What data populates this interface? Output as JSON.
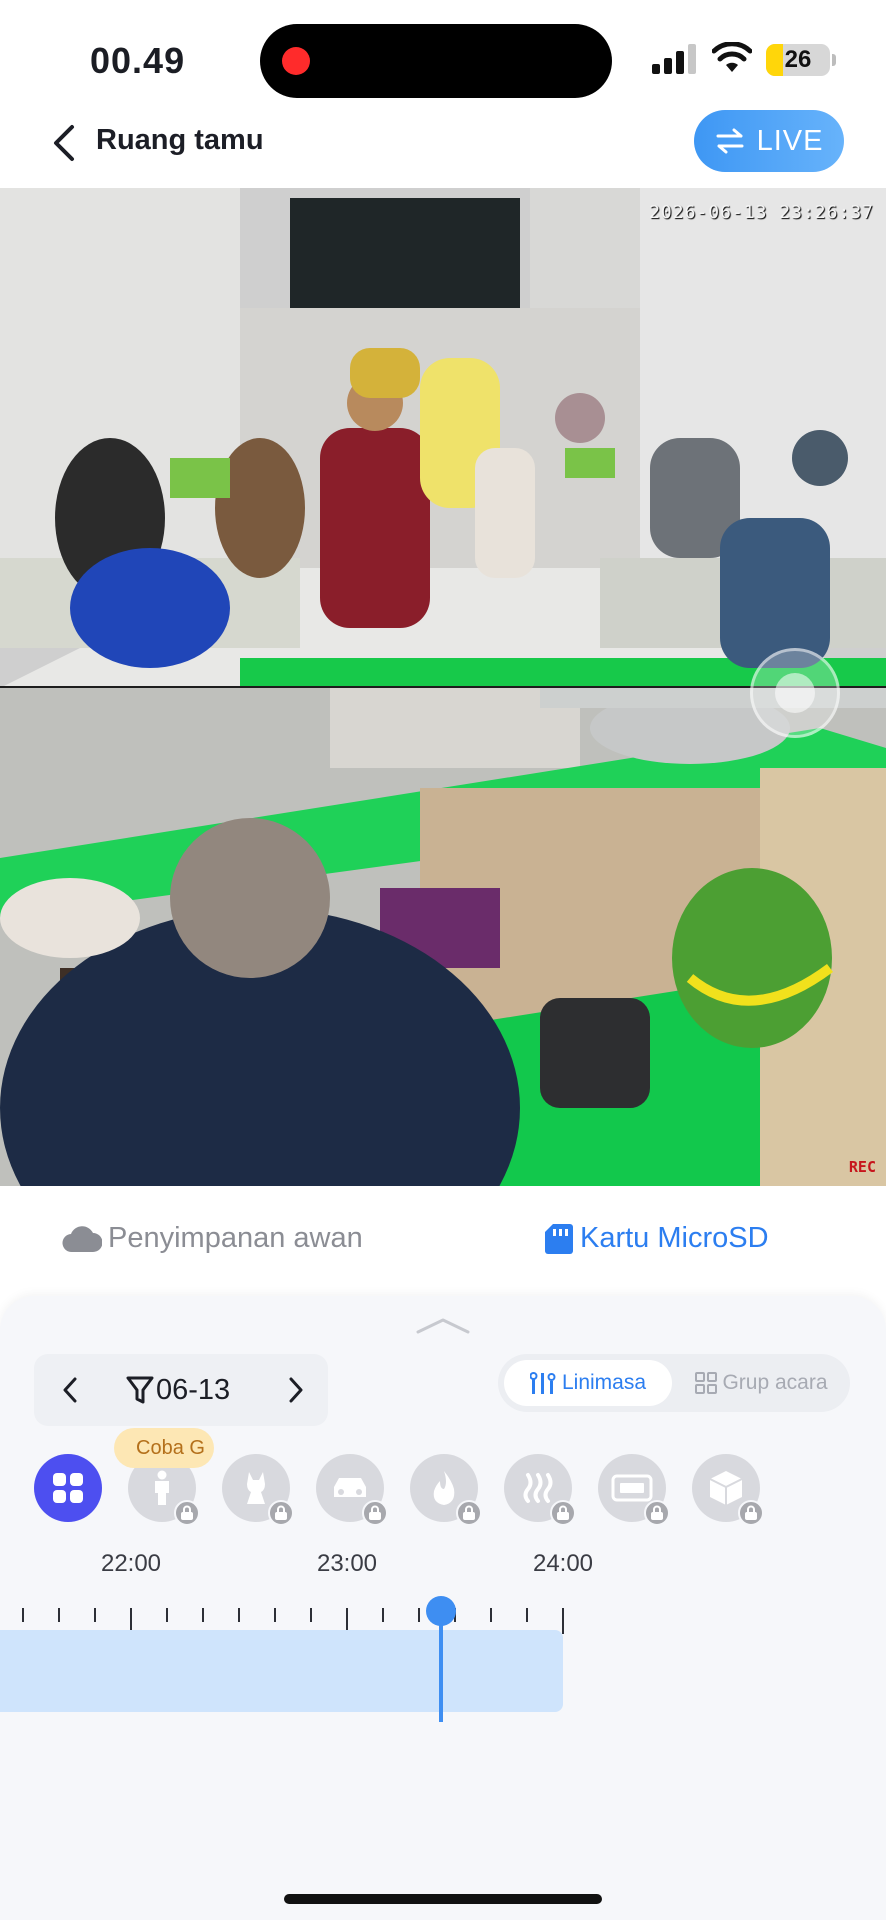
{
  "status_bar": {
    "time": "00.49",
    "battery": "26",
    "battery_level": 0.26
  },
  "header": {
    "title": "Ruang tamu",
    "live_label": "LIVE"
  },
  "camera": {
    "timestamp": "2026-06-13 23:26:37",
    "rec_label": "REC"
  },
  "storage_tabs": {
    "cloud": "Penyimpanan awan",
    "sd": "Kartu MicroSD",
    "active": "sd"
  },
  "playback": {
    "date": "06-13",
    "view_timeline": "Linimasa",
    "view_events": "Grup acara",
    "try_badge": "Coba G",
    "filters": [
      {
        "icon": "all-events-icon",
        "active": true
      },
      {
        "icon": "person-icon",
        "locked": true
      },
      {
        "icon": "pet-icon",
        "locked": true
      },
      {
        "icon": "vehicle-icon",
        "locked": true
      },
      {
        "icon": "fire-icon",
        "locked": true
      },
      {
        "icon": "smoke-icon",
        "locked": true
      },
      {
        "icon": "license-plate-icon",
        "locked": true
      },
      {
        "icon": "package-icon",
        "locked": true
      }
    ],
    "timeline": {
      "labels": [
        "22:00",
        "23:00",
        "24:00"
      ],
      "recorded_until": "24:00",
      "playhead_time": "23:26"
    }
  },
  "colors": {
    "accent": "#2c7ef0",
    "live_gradient": "#3e97f4",
    "filter_active": "#4d4ff0",
    "track": "#cfe4fc"
  }
}
